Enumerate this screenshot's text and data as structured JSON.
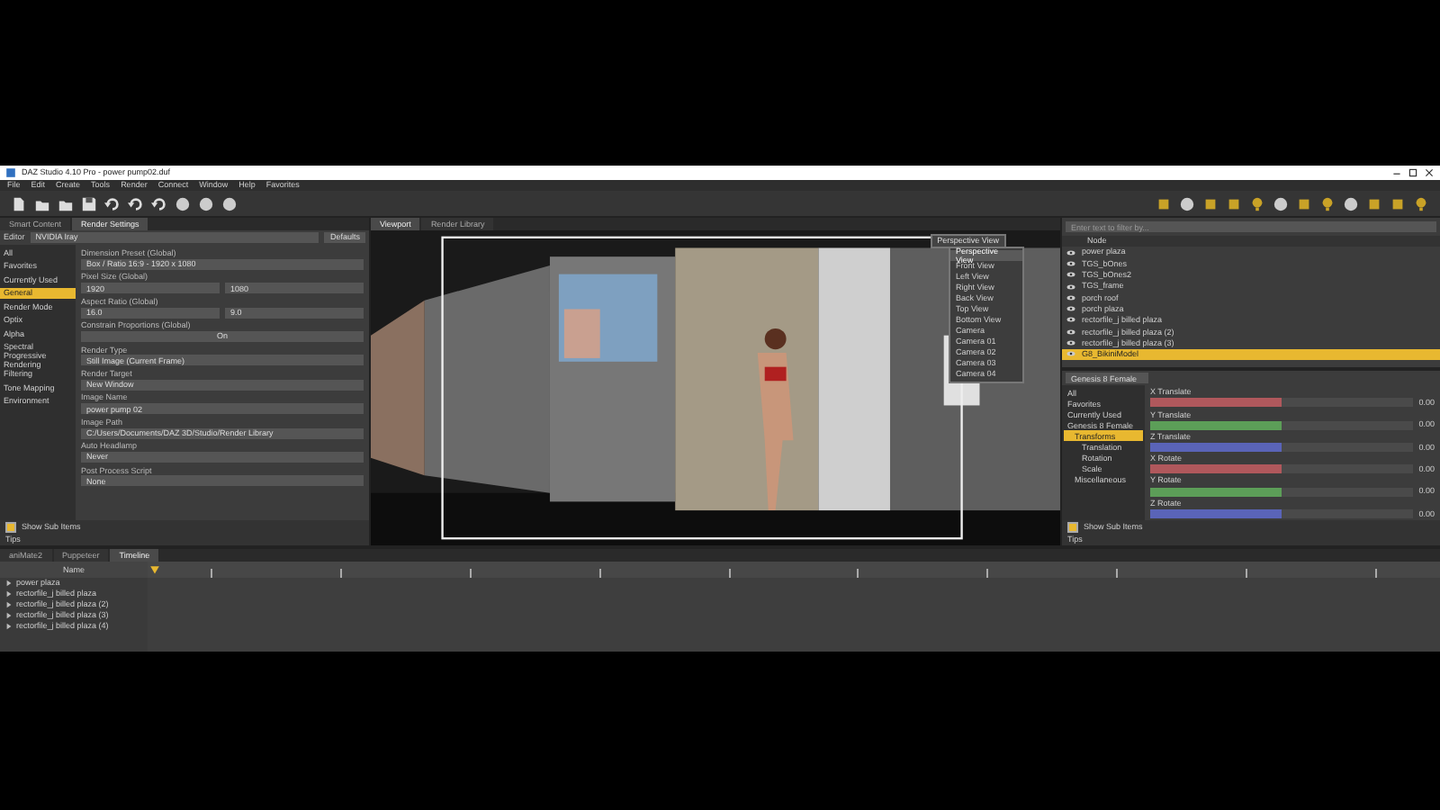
{
  "window": {
    "title": "DAZ Studio 4.10 Pro - power pump02.duf"
  },
  "menu": [
    "File",
    "Edit",
    "Create",
    "Tools",
    "Render",
    "Connect",
    "Window",
    "Help",
    "Favorites"
  ],
  "left_panel": {
    "tabs": [
      {
        "label": "Smart Content",
        "selected": false
      },
      {
        "label": "Render Settings",
        "selected": true
      }
    ],
    "preset_label": "Editor",
    "preset_value": "NVIDIA Iray",
    "preset_button": "Defaults",
    "categories": [
      {
        "label": "All",
        "selected": false
      },
      {
        "label": "Favorites",
        "selected": false
      },
      {
        "label": "Currently Used",
        "selected": false
      },
      {
        "label": "General",
        "selected": true
      },
      {
        "label": "Render Mode",
        "selected": false
      },
      {
        "label": "Optix",
        "selected": false
      },
      {
        "label": "Alpha",
        "selected": false
      },
      {
        "label": "Spectral",
        "selected": false
      },
      {
        "label": "Progressive Rendering",
        "selected": false
      },
      {
        "label": "Filtering",
        "selected": false
      },
      {
        "label": "Tone Mapping",
        "selected": false
      },
      {
        "label": "Environment",
        "selected": false
      }
    ],
    "properties": [
      {
        "label": "Dimension Preset (Global)",
        "value": "Box / Ratio 16:9 - 1920 x 1080",
        "kind": "dropdown"
      },
      {
        "label": "Pixel Size (Global)",
        "value": "1920",
        "value_2": "1080",
        "kind": "pair"
      },
      {
        "label": "Aspect Ratio (Global)",
        "value": "16.0",
        "value_2": "9.0",
        "kind": "pair"
      },
      {
        "label": "Constrain Proportions (Global)",
        "value": "On",
        "kind": "toggle"
      },
      {
        "label": "Render Type",
        "value": "Still Image (Current Frame)",
        "kind": "dropdown"
      },
      {
        "label": "Render Target",
        "value": "New Window",
        "kind": "dropdown"
      },
      {
        "label": "Image Name",
        "value": "power pump 02",
        "kind": "dropdown"
      },
      {
        "label": "Image Path",
        "value": "C:/Users/Documents/DAZ 3D/Studio/Render Library",
        "kind": "path"
      },
      {
        "label": "Auto Headlamp",
        "value": "Never",
        "kind": "dropdown"
      },
      {
        "label": "Post Process Script",
        "value": "None",
        "kind": "dropdown"
      }
    ],
    "show_sub_items": {
      "label": "Show Sub Items",
      "checked": true
    },
    "tips": "Tips"
  },
  "viewport": {
    "tabs": [
      {
        "label": "Viewport",
        "selected": true
      },
      {
        "label": "Render Library",
        "selected": false
      }
    ],
    "camera": "Perspective View",
    "camera_menu": [
      {
        "label": "Perspective View",
        "selected": true
      },
      {
        "label": "Front View",
        "selected": false
      },
      {
        "label": "Left View",
        "selected": false
      },
      {
        "label": "Right View",
        "selected": false
      },
      {
        "label": "Back View",
        "selected": false
      },
      {
        "label": "Top View",
        "selected": false
      },
      {
        "label": "Bottom View",
        "selected": false
      },
      {
        "label": "Camera",
        "selected": false
      },
      {
        "label": "Camera 01",
        "selected": false
      },
      {
        "label": "Camera 02",
        "selected": false
      },
      {
        "label": "Camera 03",
        "selected": false
      },
      {
        "label": "Camera 04",
        "selected": false
      }
    ]
  },
  "scene": {
    "search": {
      "placeholder": "Enter text to filter by..."
    },
    "header": "Node",
    "items": [
      {
        "label": "power plaza",
        "selected": false
      },
      {
        "label": "TGS_bOnes",
        "selected": false
      },
      {
        "label": "TGS_bOnes2",
        "selected": false
      },
      {
        "label": "TGS_frame",
        "selected": false
      },
      {
        "label": "porch roof",
        "selected": false
      },
      {
        "label": "porch plaza",
        "selected": false
      },
      {
        "label": "rectorfile_j billed plaza",
        "selected": false
      },
      {
        "label": "rectorfile_j billed plaza (2)",
        "selected": false
      },
      {
        "label": "rectorfile_j billed plaza (3)",
        "selected": false
      },
      {
        "label": "G8_BikiniModel",
        "selected": true
      }
    ]
  },
  "parameters": {
    "filter": "Genesis 8 Female",
    "tree": [
      {
        "label": "All",
        "selected": false
      },
      {
        "label": "Favorites",
        "selected": false
      },
      {
        "label": "Currently Used",
        "selected": false
      },
      {
        "label": "Genesis 8 Female",
        "selected": false,
        "children": [
          {
            "label": "Transforms",
            "selected": true,
            "children": [
              {
                "label": "Translation",
                "selected": false
              },
              {
                "label": "Rotation",
                "selected": false
              },
              {
                "label": "Scale",
                "selected": false
              }
            ]
          },
          {
            "label": "Miscellaneous",
            "selected": false
          }
        ]
      }
    ],
    "sliders": [
      {
        "name": "X Translate",
        "value": "0.00",
        "level": 0.5,
        "color": "#b0585c"
      },
      {
        "name": "Y Translate",
        "value": "0.00",
        "level": 0.5,
        "color": "#5c9e58"
      },
      {
        "name": "Z Translate",
        "value": "0.00",
        "level": 0.5,
        "color": "#5a64b8"
      },
      {
        "name": "X Rotate",
        "value": "0.00",
        "level": 0.5,
        "color": "#b0585c"
      },
      {
        "name": "Y Rotate",
        "value": "0.00",
        "level": 0.5,
        "color": "#5c9e58"
      },
      {
        "name": "Z Rotate",
        "value": "0.00",
        "level": 0.5,
        "color": "#5a64b8"
      }
    ],
    "show_sub_items": {
      "label": "Show Sub Items",
      "checked": true
    },
    "tips": "Tips"
  },
  "timeline": {
    "tabs": [
      {
        "label": "aniMate2",
        "selected": false
      },
      {
        "label": "Puppeteer",
        "selected": false
      },
      {
        "label": "Timeline",
        "selected": true
      }
    ],
    "column": "Name",
    "rows": [
      {
        "label": "power plaza"
      },
      {
        "label": "rectorfile_j billed plaza"
      },
      {
        "label": "rectorfile_j billed plaza (2)"
      },
      {
        "label": "rectorfile_j billed plaza (3)"
      },
      {
        "label": "rectorfile_j billed plaza (4)"
      }
    ]
  }
}
